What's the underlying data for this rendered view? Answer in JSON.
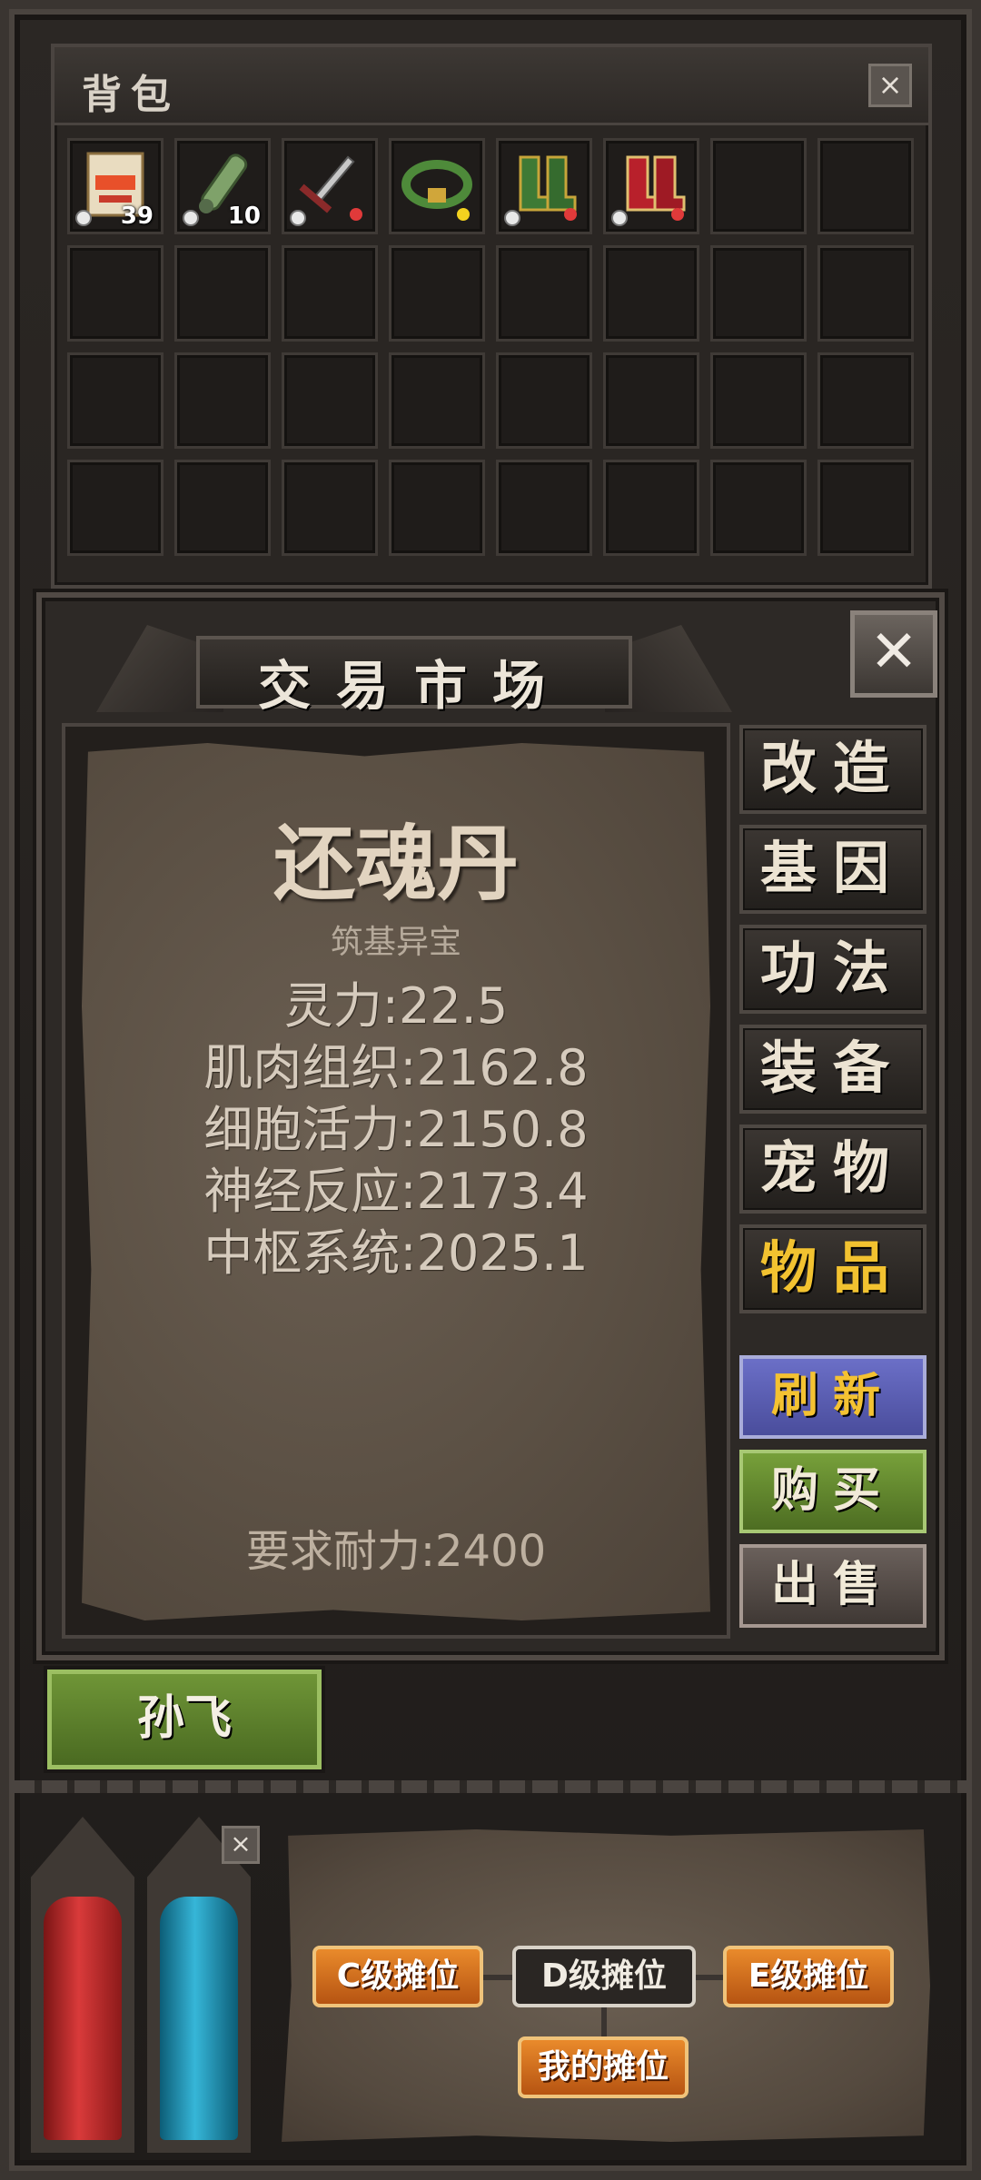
{
  "backpack": {
    "title": "背包",
    "close": "×",
    "items": [
      {
        "name": "还魂丹包",
        "qty": "39",
        "color": "#d9c59a",
        "icon": "pill-box-icon",
        "locked": true,
        "dot": null
      },
      {
        "name": "炮筒",
        "qty": "10",
        "color": "#7fa26a",
        "icon": "cannon-icon",
        "locked": true,
        "dot": null
      },
      {
        "name": "剑",
        "qty": "",
        "color": "#b8b8b8",
        "icon": "sword-icon",
        "locked": true,
        "dot": "#e03a3a"
      },
      {
        "name": "腰带",
        "qty": "",
        "color": "#4e8a3a",
        "icon": "belt-icon",
        "locked": false,
        "dot": "#f3d21f"
      },
      {
        "name": "绿靴",
        "qty": "",
        "color": "#3e7a35",
        "icon": "green-boots-icon",
        "locked": true,
        "dot": "#e03a3a"
      },
      {
        "name": "红靴",
        "qty": "",
        "color": "#b8202b",
        "icon": "red-boots-icon",
        "locked": true,
        "dot": "#e03a3a"
      }
    ]
  },
  "market": {
    "title": "交易市场",
    "close": "✕",
    "item": {
      "name": "还魂丹",
      "subtitle": "筑基异宝",
      "stats": [
        "灵力:22.5",
        "肌肉组织:2162.8",
        "细胞活力:2150.8",
        "神经反应:2173.4",
        "中枢系统:2025.1"
      ],
      "requirement": "要求耐力:2400"
    },
    "tabs": [
      {
        "label": "改造",
        "active": false
      },
      {
        "label": "基因",
        "active": false
      },
      {
        "label": "功法",
        "active": false
      },
      {
        "label": "装备",
        "active": false
      },
      {
        "label": "宠物",
        "active": false
      },
      {
        "label": "物品",
        "active": true
      }
    ],
    "actions": {
      "refresh": "刷新",
      "buy": "购买",
      "sell": "出售"
    },
    "accent_color": "#f2c230"
  },
  "seller": {
    "name": "孙飞"
  },
  "stalls": {
    "close": "×",
    "c_stall": "C级摊位",
    "d_stall": "D级摊位",
    "e_stall": "E级摊位",
    "my_stall": "我的摊位"
  }
}
